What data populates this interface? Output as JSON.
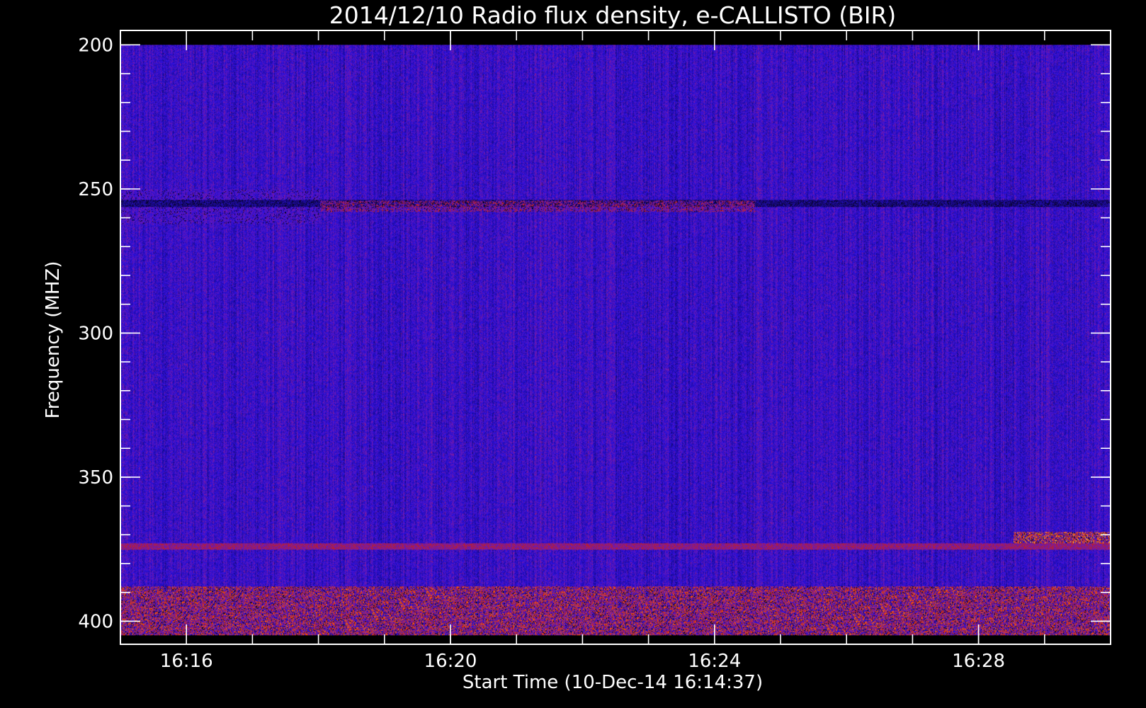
{
  "chart_data": {
    "type": "heatmap",
    "title": "2014/12/10  Radio flux density, e-CALLISTO (BIR)",
    "xlabel": "Start Time (10-Dec-14 16:14:37)",
    "ylabel": "Frequency (MHZ)",
    "x_range_minutes": [
      0.38,
      15.38
    ],
    "x_data_start": "16:15:00",
    "x_data_end": "16:30:00",
    "y_range": [
      195,
      408
    ],
    "y_data_range": [
      200,
      405
    ],
    "y_inverted": true,
    "x_ticks": [
      {
        "label": "16:16",
        "minutes": 1.38
      },
      {
        "label": "16:20",
        "minutes": 5.38
      },
      {
        "label": "16:24",
        "minutes": 9.38
      },
      {
        "label": "16:28",
        "minutes": 13.38
      }
    ],
    "y_ticks": [
      {
        "label": "200",
        "value": 200
      },
      {
        "label": "250",
        "value": 250
      },
      {
        "label": "300",
        "value": 300
      },
      {
        "label": "350",
        "value": 350
      },
      {
        "label": "400",
        "value": 400
      }
    ],
    "grid": false,
    "colormap": [
      "#000000",
      "#1a0a8a",
      "#2a10e0",
      "#7a1aa8",
      "#c0201e",
      "#ff5a00",
      "#ffd24a"
    ],
    "background_level": "blue",
    "features": [
      {
        "kind": "band",
        "freq": [
          250,
          262
        ],
        "time": [
          0.38,
          3.4
        ],
        "intensity": 0.45
      },
      {
        "kind": "line",
        "freq": 255,
        "time": [
          0.38,
          15.38
        ],
        "intensity": 0.15
      },
      {
        "kind": "band",
        "freq": [
          254,
          258
        ],
        "time": [
          3.4,
          10.0
        ],
        "intensity": 0.65
      },
      {
        "kind": "line",
        "freq": 374,
        "time": [
          0.38,
          15.38
        ],
        "intensity": 0.55
      },
      {
        "kind": "band",
        "freq": [
          369,
          373
        ],
        "time": [
          13.9,
          15.38
        ],
        "intensity": 0.9
      },
      {
        "kind": "band",
        "freq": [
          388,
          405
        ],
        "time": [
          0.38,
          15.38
        ],
        "intensity": 0.8
      }
    ]
  }
}
